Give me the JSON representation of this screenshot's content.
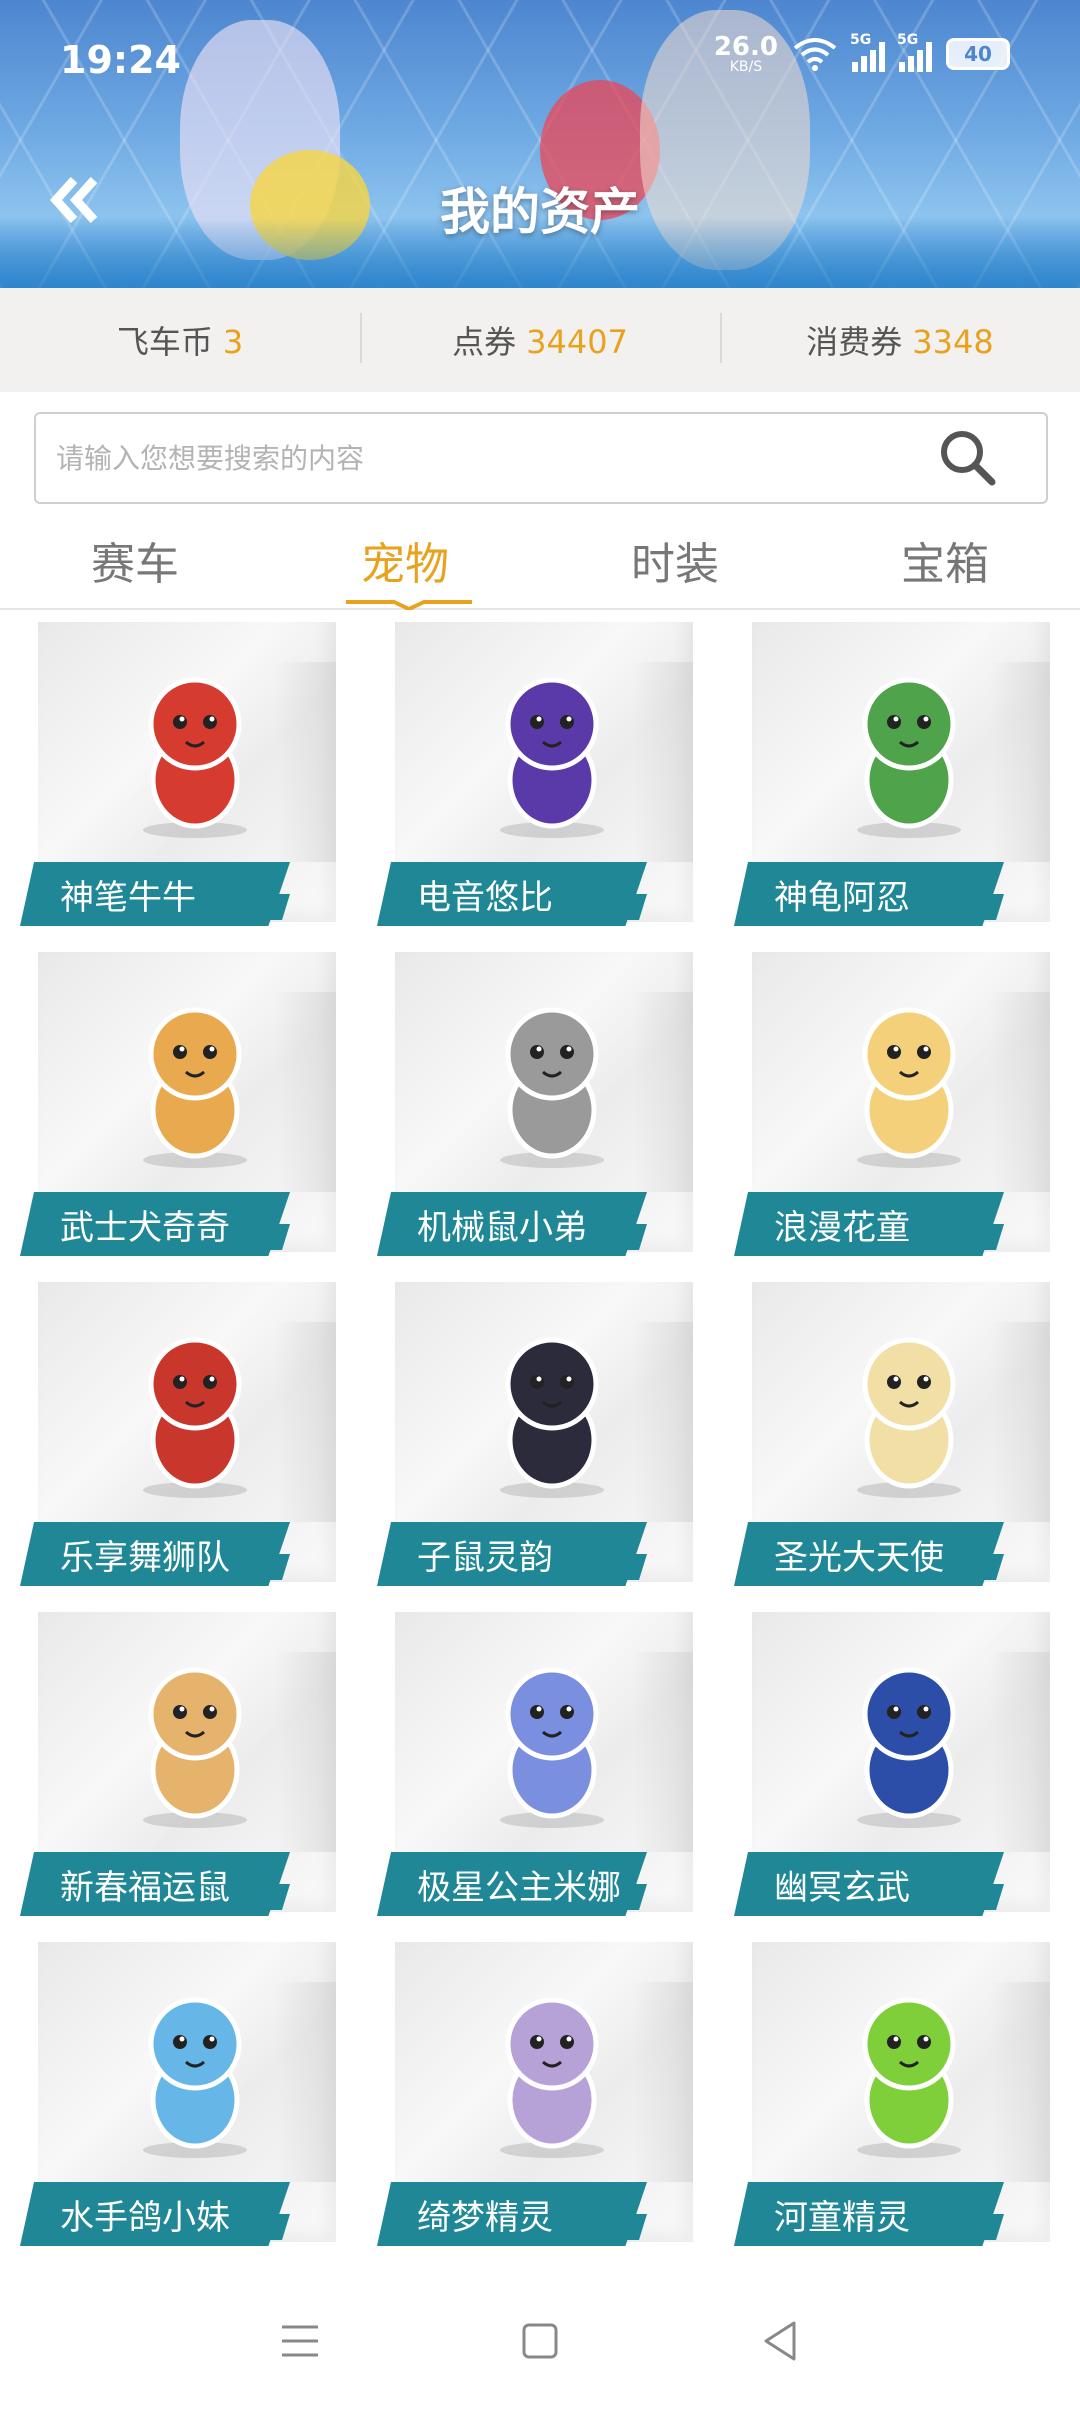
{
  "status_bar": {
    "time": "19:24",
    "net_speed_value": "26.0",
    "net_speed_unit": "KB/S",
    "signal1_tag": "5G",
    "signal2_tag": "5G",
    "battery": "40"
  },
  "header": {
    "title": "我的资产",
    "back_icon": "double-chevron-left-icon"
  },
  "currencies": [
    {
      "label": "飞车币",
      "value": "3"
    },
    {
      "label": "点券",
      "value": "34407"
    },
    {
      "label": "消费券",
      "value": "3348"
    }
  ],
  "search": {
    "placeholder": "请输入您想要搜索的内容",
    "value": "",
    "icon": "search-icon"
  },
  "tabs": [
    {
      "label": "赛车",
      "active": false
    },
    {
      "label": "宠物",
      "active": true
    },
    {
      "label": "时装",
      "active": false
    },
    {
      "label": "宝箱",
      "active": false
    }
  ],
  "pets": [
    {
      "name": "神笔牛牛",
      "color": "#d63b2f"
    },
    {
      "name": "电音悠比",
      "color": "#5a3aa8"
    },
    {
      "name": "神龟阿忍",
      "color": "#4fa34a"
    },
    {
      "name": "武士犬奇奇",
      "color": "#e8a94f"
    },
    {
      "name": "机械鼠小弟",
      "color": "#9a9a9a"
    },
    {
      "name": "浪漫花童",
      "color": "#f5d07a"
    },
    {
      "name": "乐享舞狮队",
      "color": "#c8362c"
    },
    {
      "name": "子鼠灵韵",
      "color": "#2b2b3c"
    },
    {
      "name": "圣光大天使",
      "color": "#f2dfa6"
    },
    {
      "name": "新春福运鼠",
      "color": "#e6b36d"
    },
    {
      "name": "极星公主米娜",
      "color": "#7a8fe0"
    },
    {
      "name": "幽冥玄武",
      "color": "#2c4ea8"
    },
    {
      "name": "水手鸽小妹",
      "color": "#66b6e8"
    },
    {
      "name": "绮梦精灵",
      "color": "#b7a2d8"
    },
    {
      "name": "河童精灵",
      "color": "#7fcf3a"
    }
  ],
  "colors": {
    "accent": "#e8a21e",
    "label_bg": "#1f8795",
    "currency_bar_bg": "#f2f1ef"
  },
  "bottom_nav": [
    "menu-icon",
    "home-square-icon",
    "back-triangle-icon"
  ]
}
